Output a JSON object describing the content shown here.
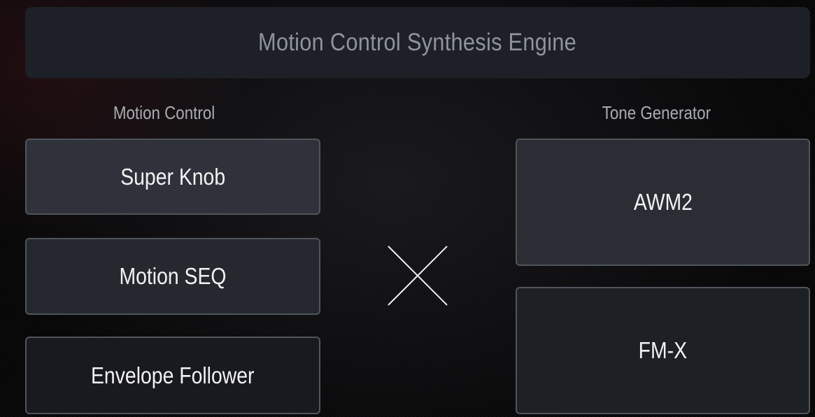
{
  "header": {
    "title": "Motion Control Synthesis Engine"
  },
  "motion_control": {
    "label": "Motion Control",
    "items": [
      {
        "label": "Super Knob"
      },
      {
        "label": "Motion SEQ"
      },
      {
        "label": "Envelope Follower"
      }
    ]
  },
  "tone_generator": {
    "label": "Tone Generator",
    "items": [
      {
        "label": "AWM2"
      },
      {
        "label": "FM-X"
      }
    ]
  },
  "icons": {
    "combine": "multiply-cross-icon"
  }
}
